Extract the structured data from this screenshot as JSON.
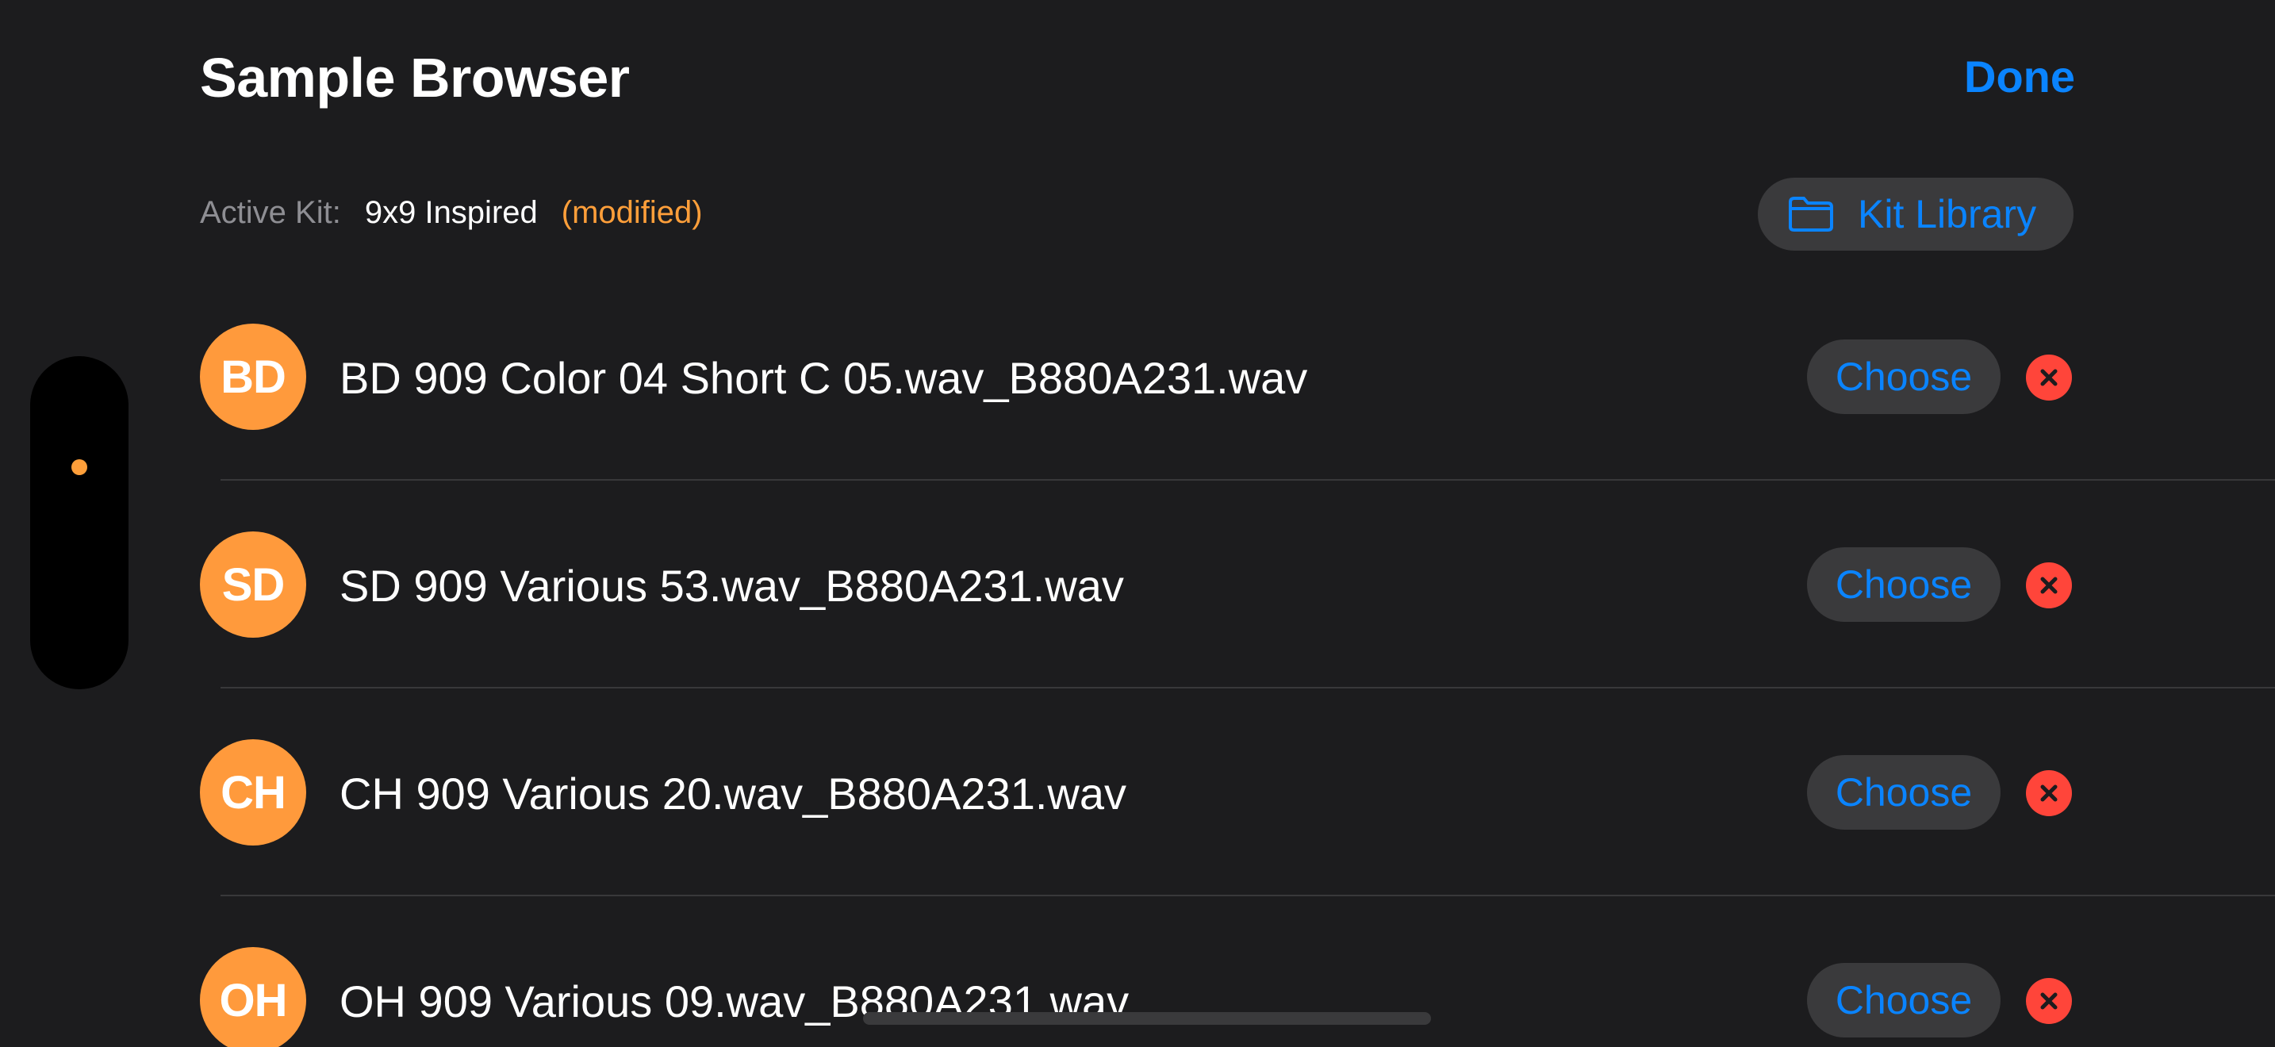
{
  "header": {
    "title": "Sample Browser",
    "done_label": "Done"
  },
  "kit": {
    "label": "Active Kit:",
    "name": "9x9 Inspired",
    "status": "(modified)",
    "library_button_label": "Kit Library",
    "library_icon": "folder-icon"
  },
  "samples": [
    {
      "pad": "BD",
      "name": "BD 909 Color 04 Short C 05.wav_B880A231.wav",
      "choose_label": "Choose"
    },
    {
      "pad": "SD",
      "name": "SD 909 Various 53.wav_B880A231.wav",
      "choose_label": "Choose"
    },
    {
      "pad": "CH",
      "name": "CH 909 Various 20.wav_B880A231.wav",
      "choose_label": "Choose"
    },
    {
      "pad": "OH",
      "name": "OH 909 Various 09.wav_B880A231.wav",
      "choose_label": "Choose"
    }
  ],
  "colors": {
    "accent": "#0a84ff",
    "pad": "#ff9a3c",
    "modified": "#ff9f3a",
    "remove": "#ff453a",
    "background": "#1c1c1e"
  }
}
